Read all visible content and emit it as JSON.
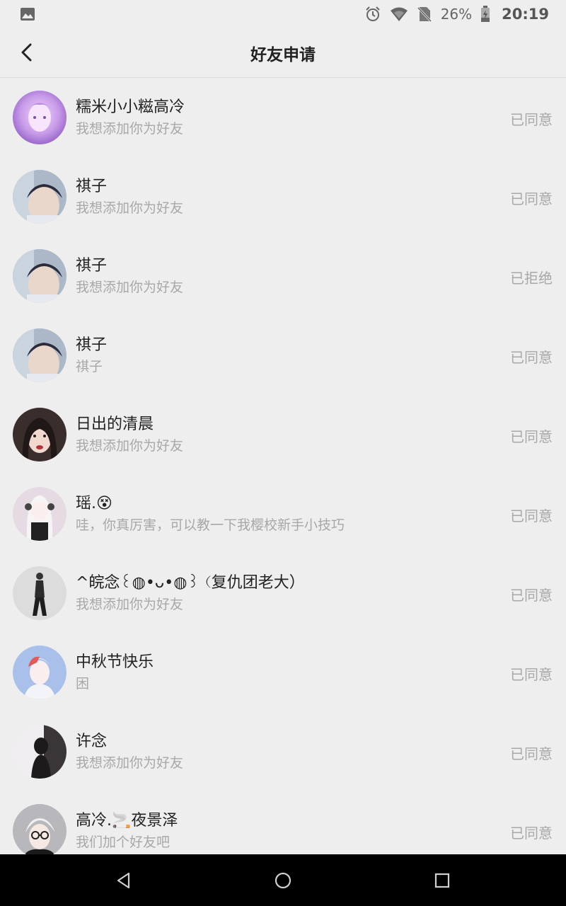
{
  "status_bar": {
    "battery_percent": "26%",
    "time": "20:19",
    "icons": [
      "gallery-icon",
      "alarm-icon",
      "wifi-icon",
      "no-sim-icon",
      "battery-icon"
    ]
  },
  "header": {
    "title": "好友申请",
    "back_icon": "chevron-left-icon"
  },
  "requests": [
    {
      "name": "糯米小小糍高冷",
      "message": "我想添加你为好友",
      "status": "已同意"
    },
    {
      "name": "祺子",
      "message": "我想添加你为好友",
      "status": "已同意"
    },
    {
      "name": "祺子",
      "message": "我想添加你为好友",
      "status": "已拒绝"
    },
    {
      "name": "祺子",
      "message": "祺子",
      "status": "已同意"
    },
    {
      "name": "日出的清晨",
      "message": "我想添加你为好友",
      "status": "已同意"
    },
    {
      "name": "瑶.",
      "name_emoji": "😵",
      "message": "哇，你真厉害，可以教一下我樱校新手小技巧",
      "status": "已同意"
    },
    {
      "name": "^皖念꒰◍•ᴗ•◍꒱（复仇团老大）",
      "message": "我想添加你为好友",
      "status": "已同意"
    },
    {
      "name": "中秋节快乐",
      "message": "困",
      "status": "已同意"
    },
    {
      "name": "许念",
      "message": "我想添加你为好友",
      "status": "已同意"
    },
    {
      "name": "高冷.🚬夜景泽",
      "message": "我们加个好友吧",
      "status": "已同意"
    }
  ],
  "nav_bar": {
    "icons": [
      "back-triangle-icon",
      "home-circle-icon",
      "recents-square-icon"
    ]
  }
}
